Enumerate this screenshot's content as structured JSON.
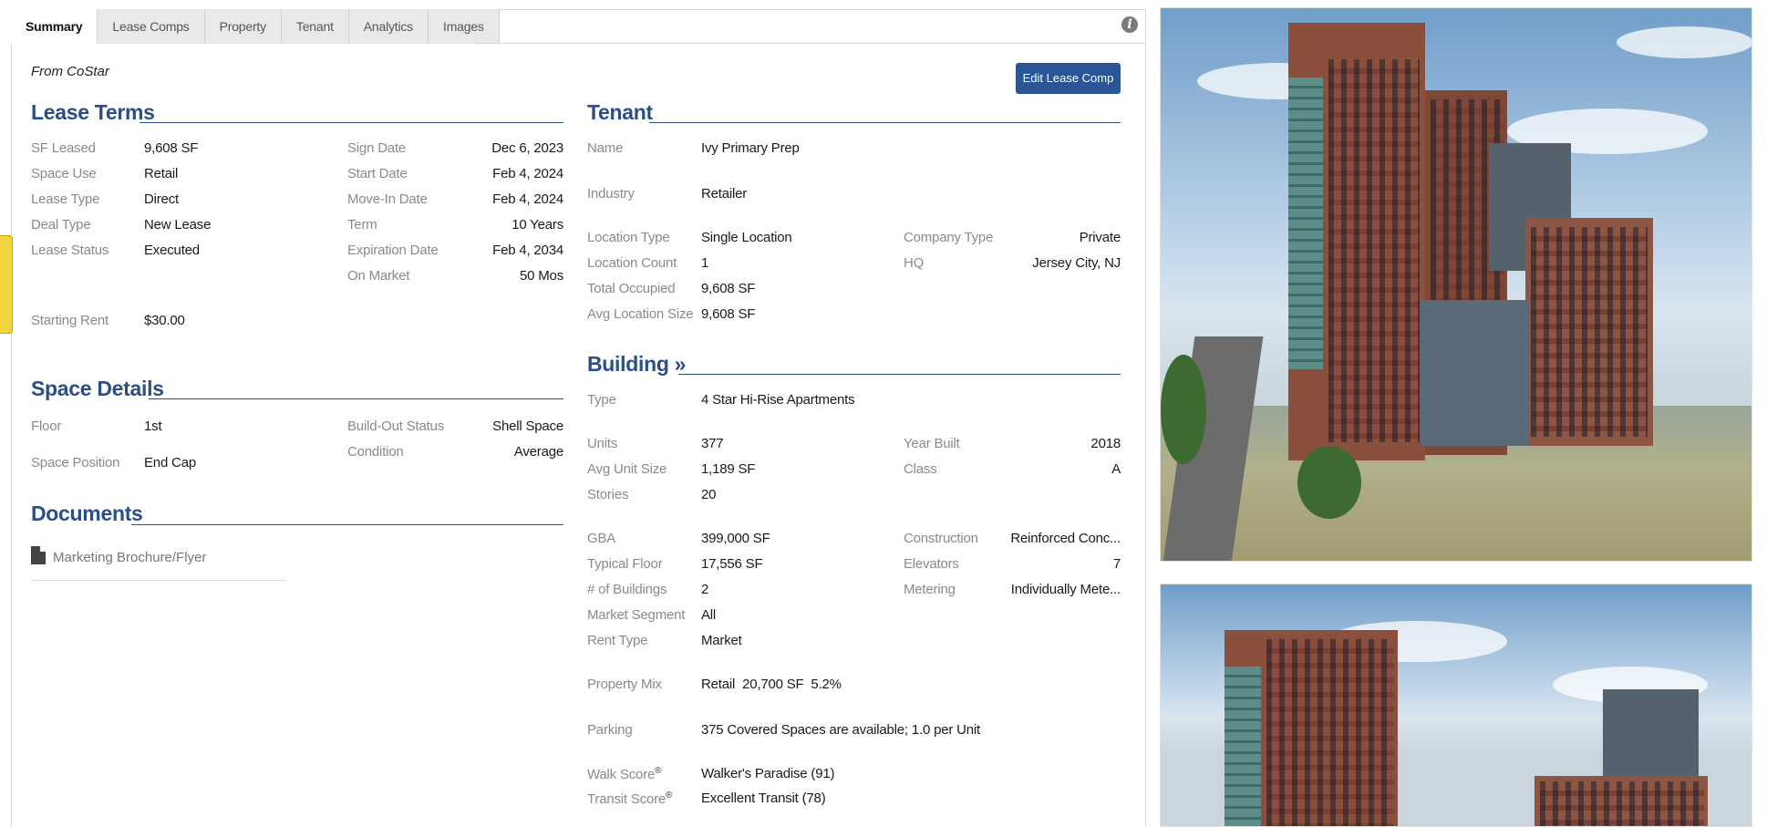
{
  "tabs": [
    {
      "label": "Summary",
      "active": true
    },
    {
      "label": "Lease Comps",
      "active": false
    },
    {
      "label": "Property",
      "active": false
    },
    {
      "label": "Tenant",
      "active": false
    },
    {
      "label": "Analytics",
      "active": false
    },
    {
      "label": "Images",
      "active": false
    }
  ],
  "source": "From CoStar",
  "edit_button": "Edit Lease Comp",
  "lease_terms": {
    "title": "Lease Terms",
    "left": [
      {
        "label": "SF Leased",
        "value": "9,608 SF"
      },
      {
        "label": "Space Use",
        "value": "Retail"
      },
      {
        "label": "Lease Type",
        "value": "Direct"
      },
      {
        "label": "Deal Type",
        "value": "New Lease"
      },
      {
        "label": "Lease Status",
        "value": "Executed"
      }
    ],
    "right": [
      {
        "label": "Sign Date",
        "value": "Dec 6, 2023"
      },
      {
        "label": "Start Date",
        "value": "Feb 4, 2024"
      },
      {
        "label": "Move-In Date",
        "value": "Feb 4, 2024"
      },
      {
        "label": "Term",
        "value": "10 Years"
      },
      {
        "label": "Expiration Date",
        "value": "Feb 4, 2034"
      },
      {
        "label": "On Market",
        "value": "50 Mos"
      }
    ],
    "starting_rent": {
      "label": "Starting Rent",
      "value": "$30.00"
    }
  },
  "space_details": {
    "title": "Space Details",
    "floor": {
      "label": "Floor",
      "value": "1st"
    },
    "space_position": {
      "label": "Space Position",
      "value": "End Cap"
    },
    "build_out": {
      "label": "Build-Out Status",
      "value": "Shell Space"
    },
    "condition": {
      "label": "Condition",
      "value": "Average"
    }
  },
  "documents": {
    "title": "Documents",
    "items": [
      "Marketing Brochure/Flyer"
    ]
  },
  "tenant": {
    "title": "Tenant",
    "name": {
      "label": "Name",
      "value": "Ivy Primary Prep"
    },
    "industry": {
      "label": "Industry",
      "value": "Retailer"
    },
    "location_type": {
      "label": "Location Type",
      "value": "Single Location"
    },
    "location_count": {
      "label": "Location Count",
      "value": "1"
    },
    "total_occupied": {
      "label": "Total Occupied",
      "value": "9,608 SF"
    },
    "avg_location_size": {
      "label": "Avg Location Size",
      "value": "9,608 SF"
    },
    "company_type": {
      "label": "Company Type",
      "value": "Private"
    },
    "hq": {
      "label": "HQ",
      "value": "Jersey City, NJ"
    }
  },
  "building": {
    "title": "Building »",
    "type": {
      "label": "Type",
      "value": "4 Star Hi-Rise Apartments"
    },
    "units": {
      "label": "Units",
      "value": "377"
    },
    "avg_unit_size": {
      "label": "Avg Unit Size",
      "value": "1,189 SF"
    },
    "stories": {
      "label": "Stories",
      "value": "20"
    },
    "year_built": {
      "label": "Year Built",
      "value": "2018"
    },
    "class": {
      "label": "Class",
      "value": "A"
    },
    "gba": {
      "label": "GBA",
      "value": "399,000 SF"
    },
    "typical_floor": {
      "label": "Typical Floor",
      "value": "17,556 SF"
    },
    "num_buildings": {
      "label": "# of Buildings",
      "value": "2"
    },
    "market_segment": {
      "label": "Market Segment",
      "value": "All"
    },
    "rent_type": {
      "label": "Rent Type",
      "value": "Market"
    },
    "construction": {
      "label": "Construction",
      "value": "Reinforced Conc..."
    },
    "elevators": {
      "label": "Elevators",
      "value": "7"
    },
    "metering": {
      "label": "Metering",
      "value": "Individually Mete..."
    },
    "property_mix": {
      "label": "Property Mix",
      "value": "Retail  20,700 SF  5.2%"
    },
    "parking": {
      "label": "Parking",
      "value": "375 Covered Spaces are available; 1.0 per Unit"
    },
    "walk_score": {
      "label": "Walk Score",
      "value": "Walker's Paradise (91)"
    },
    "transit_score": {
      "label": "Transit Score",
      "value": "Excellent Transit (78)"
    },
    "registered_mark": "®"
  },
  "icons": {
    "info": "info-icon",
    "pdf": "pdf-icon",
    "side_tab": "side-tab-icon"
  },
  "colors": {
    "section_title": "#2a4e86",
    "button": "#2a5697",
    "side_tab": "#f2d53c"
  }
}
